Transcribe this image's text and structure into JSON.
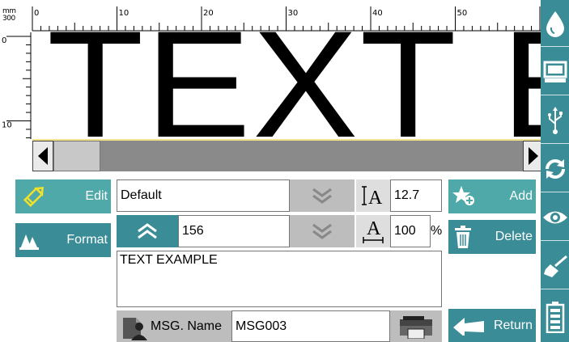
{
  "ruler": {
    "unit_top": "mm",
    "unit_bottom": "300",
    "h_labels": [
      "0",
      "10",
      "20",
      "30",
      "40",
      "50"
    ],
    "v_labels": [
      "0",
      "10"
    ]
  },
  "preview": {
    "text": "TEXT E"
  },
  "edit_button": {
    "label": "Edit",
    "icon": "pencil-icon"
  },
  "format_button": {
    "label": "Format",
    "icon": "format-icon"
  },
  "font": {
    "value": "Default"
  },
  "height": {
    "value": "12.7",
    "icon": "text-height-icon"
  },
  "spacing": {
    "value": "156"
  },
  "width": {
    "value": "100",
    "unit": "%",
    "icon": "text-width-icon"
  },
  "message_text": "TEXT EXAMPLE",
  "message_name": {
    "label": "MSG. Name",
    "value": "MSG003"
  },
  "actions": {
    "add": "Add",
    "delete": "Delete",
    "return": "Return"
  },
  "sidebar": {
    "icons": [
      "ink-drop-icon",
      "monitor-icon",
      "usb-icon",
      "refresh-icon",
      "eye-icon",
      "broom-icon",
      "battery-icon"
    ]
  },
  "colors": {
    "teal": "#3a8c96",
    "teal_light": "#4ea9a8",
    "grey": "#bdbdbd",
    "scroll": "#8a8a8a"
  }
}
